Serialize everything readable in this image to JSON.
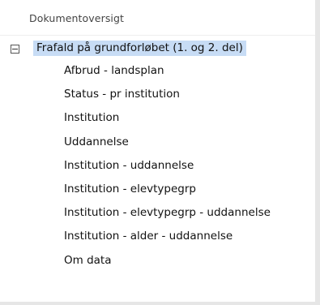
{
  "header": {
    "title": "Dokumentoversigt"
  },
  "tree": {
    "root": {
      "label": "Frafald på grundforløbet (1. og 2. del)",
      "expanded": true
    },
    "children": [
      {
        "label": "Afbrud - landsplan"
      },
      {
        "label": "Status - pr institution"
      },
      {
        "label": "Institution"
      },
      {
        "label": "Uddannelse"
      },
      {
        "label": "Institution - uddannelse"
      },
      {
        "label": "Institution - elevtypegrp"
      },
      {
        "label": "Institution - elevtypegrp - uddannelse"
      },
      {
        "label": "Institution - alder - uddannelse"
      },
      {
        "label": "Om data"
      }
    ]
  },
  "colors": {
    "selection": "#c7dcf5",
    "frame": "#e6e6e6"
  }
}
